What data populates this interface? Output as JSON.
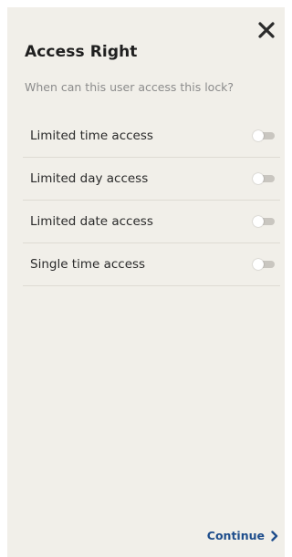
{
  "header": {
    "title": "Access Right",
    "subtitle": "When can this user access this lock?",
    "close_icon": "close-icon"
  },
  "options": [
    {
      "label": "Limited time access",
      "enabled": false
    },
    {
      "label": "Limited day access",
      "enabled": false
    },
    {
      "label": "Limited date access",
      "enabled": false
    },
    {
      "label": "Single time access",
      "enabled": false
    }
  ],
  "footer": {
    "continue_label": "Continue",
    "continue_icon": "chevron-right-icon"
  },
  "colors": {
    "background": "#f1efe9",
    "accent": "#1f4e8c",
    "divider": "#dedbd3",
    "toggle_off": "#c9c6c0"
  }
}
